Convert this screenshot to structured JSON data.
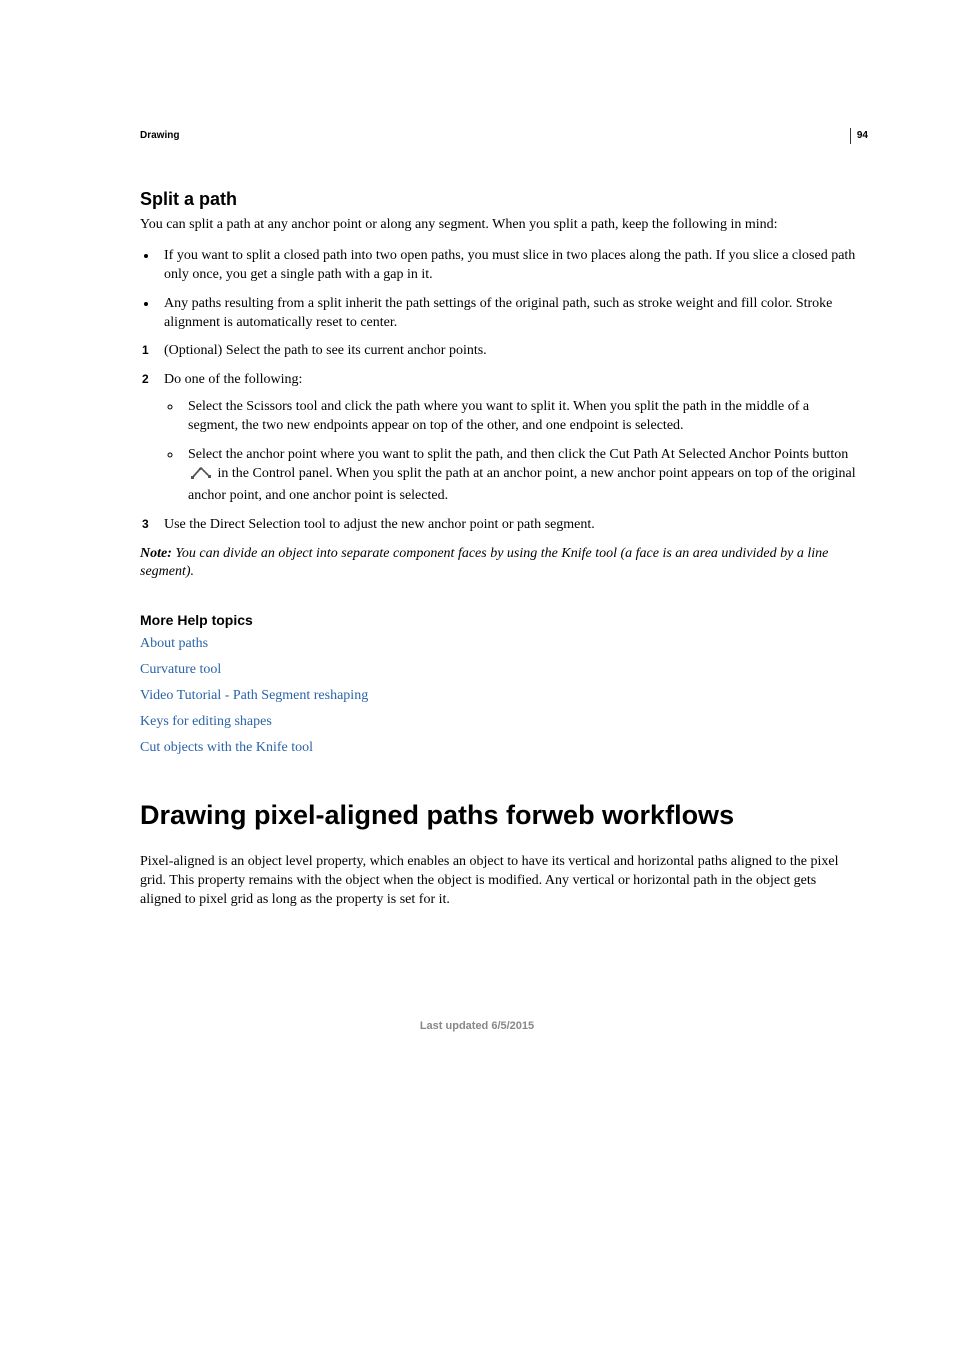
{
  "page_number": "94",
  "chapter_label": "Drawing",
  "section": {
    "heading": "Split a path",
    "intro": "You can split a path at any anchor point or along any segment. When you split a path, keep the following in mind:",
    "bullets": [
      "If you want to split a closed path into two open paths, you must slice in two places along the path. If you slice a closed path only once, you get a single path with a gap in it.",
      "Any paths resulting from a split inherit the path settings of the original path, such as stroke weight and fill color. Stroke alignment is automatically reset to center."
    ],
    "steps": [
      {
        "num": "1",
        "text": "(Optional) Select the path to see its current anchor points."
      },
      {
        "num": "2",
        "text": "Do one of the following:",
        "sub": [
          "Select the Scissors tool and click the path where you want to split it. When you split the path in the middle of a segment, the two new endpoints appear on top of the other, and one endpoint is selected.",
          {
            "before": "Select the anchor point where you want to split the path, and then click the Cut Path At Selected Anchor Points button ",
            "after": " in the Control panel. When you split the path at an anchor point, a new anchor point appears on top of the original anchor point, and one anchor point is selected."
          }
        ]
      },
      {
        "num": "3",
        "text": "Use the Direct Selection tool to adjust the new anchor point or path segment."
      }
    ],
    "note_label": "Note:",
    "note_body": " You can divide an object into separate component faces by using the Knife tool (a face is an area undivided by a line segment)."
  },
  "related": {
    "heading": "More Help topics",
    "links": [
      "About paths",
      "Curvature tool",
      "Video Tutorial - Path Segment reshaping",
      "Keys for editing shapes",
      "Cut objects with the Knife tool"
    ]
  },
  "next_section": {
    "heading": "Drawing pixel-aligned paths forweb workflows",
    "body": "Pixel-aligned is an object level property, which enables an object to have its vertical and horizontal paths aligned to the pixel grid. This property remains with the object when the object is modified. Any vertical or horizontal path in the object gets aligned to pixel grid as long as the property is set for it."
  },
  "footer": "Last updated 6/5/2015"
}
